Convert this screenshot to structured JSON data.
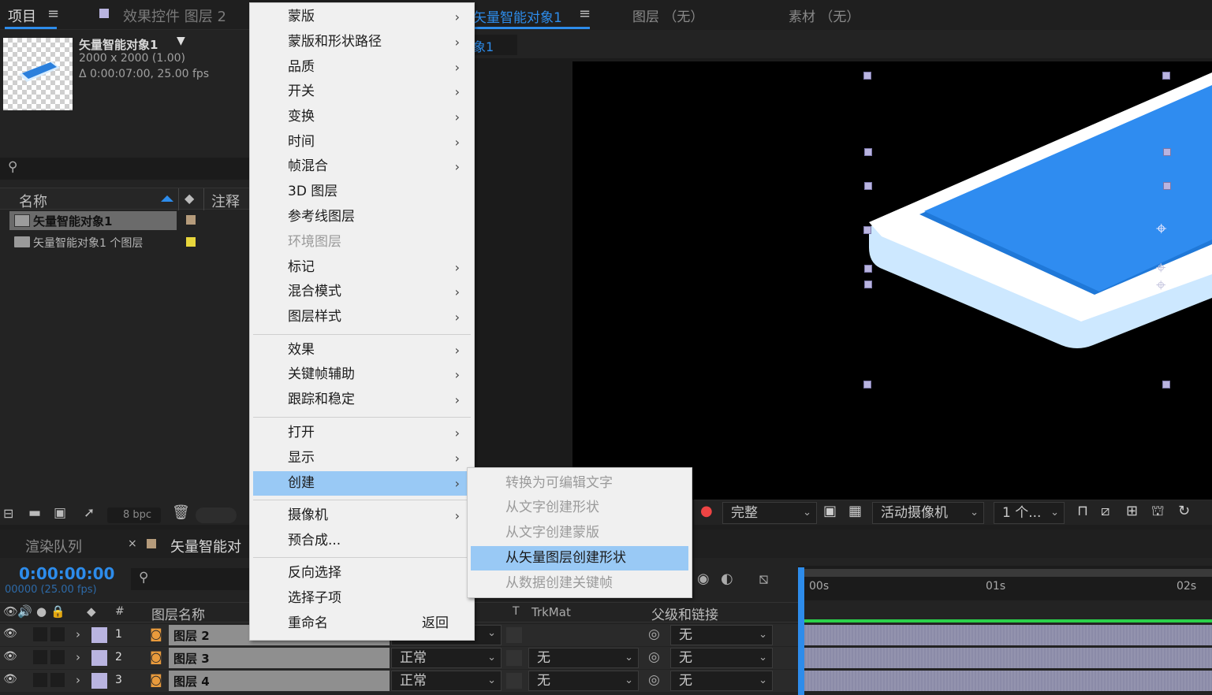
{
  "project_panel": {
    "tab_project": "项目",
    "tab_effects": "效果控件 图层 2",
    "item_name": "矢量智能对象1",
    "item_size": "2000 x 2000 (1.00)",
    "item_duration": "Δ 0:00:07:00, 25.00 fps",
    "col_name": "名称",
    "col_comment": "注释",
    "rows": [
      {
        "name": "矢量智能对象1",
        "color": "#b59b7b"
      },
      {
        "name": "矢量智能对象1 个图层",
        "color": "#e8d63c"
      }
    ],
    "bpc": "8 bpc"
  },
  "viewer": {
    "tab_comp": "矢量智能对象1",
    "tab_layer": "图层 （无）",
    "tab_footage": "素材 （无）",
    "sub_tab": "象1",
    "resolution": "完整",
    "camera": "活动摄像机",
    "views": "1 个..."
  },
  "timeline": {
    "tab_render": "渲染队列",
    "tab_comp": "矢量智能对",
    "timecode": "0:00:00:00",
    "frame": "00000 (25.00 fps)",
    "col_layer_name": "图层名称",
    "col_trkmat": "TrkMat",
    "col_parent": "父级和链接",
    "col_t": "T",
    "ruler": [
      "00s",
      "01s",
      "02s"
    ],
    "layers": [
      {
        "num": "1",
        "name": "图层 2",
        "mode": "",
        "trkmat": "",
        "parent": "无"
      },
      {
        "num": "2",
        "name": "图层 3",
        "mode": "正常",
        "trkmat": "无",
        "parent": "无"
      },
      {
        "num": "3",
        "name": "图层 4",
        "mode": "正常",
        "trkmat": "无",
        "parent": "无"
      }
    ]
  },
  "context_menu": {
    "items": [
      {
        "label": "蒙版",
        "arrow": true
      },
      {
        "label": "蒙版和形状路径",
        "arrow": true
      },
      {
        "label": "品质",
        "arrow": true
      },
      {
        "label": "开关",
        "arrow": true
      },
      {
        "label": "变换",
        "arrow": true
      },
      {
        "label": "时间",
        "arrow": true
      },
      {
        "label": "帧混合",
        "arrow": true
      },
      {
        "label": "3D 图层",
        "arrow": false
      },
      {
        "label": "参考线图层",
        "arrow": false
      },
      {
        "label": "环境图层",
        "arrow": false,
        "disabled": true
      },
      {
        "label": "标记",
        "arrow": true
      },
      {
        "label": "混合模式",
        "arrow": true
      },
      {
        "label": "图层样式",
        "arrow": true
      },
      {
        "label": "效果",
        "arrow": true
      },
      {
        "label": "关键帧辅助",
        "arrow": true
      },
      {
        "label": "跟踪和稳定",
        "arrow": true
      },
      {
        "label": "打开",
        "arrow": true
      },
      {
        "label": "显示",
        "arrow": true
      },
      {
        "label": "创建",
        "arrow": true,
        "highlighted": true
      },
      {
        "label": "摄像机",
        "arrow": true
      },
      {
        "label": "预合成...",
        "arrow": false
      },
      {
        "label": "反向选择",
        "arrow": false
      },
      {
        "label": "选择子项",
        "arrow": false
      },
      {
        "label": "重命名",
        "arrow": false,
        "shortcut": "返回"
      }
    ]
  },
  "submenu": {
    "items": [
      {
        "label": "转换为可编辑文字",
        "disabled": true
      },
      {
        "label": "从文字创建形状",
        "disabled": true
      },
      {
        "label": "从文字创建蒙版",
        "disabled": true
      },
      {
        "label": "从矢量图层创建形状",
        "highlighted": true
      },
      {
        "label": "从数据创建关键帧",
        "disabled": true
      }
    ]
  },
  "colors": {
    "accent": "#2d8ceb",
    "menu_highlight": "#99c9f5",
    "label_lavender": "#b9b4e0"
  }
}
